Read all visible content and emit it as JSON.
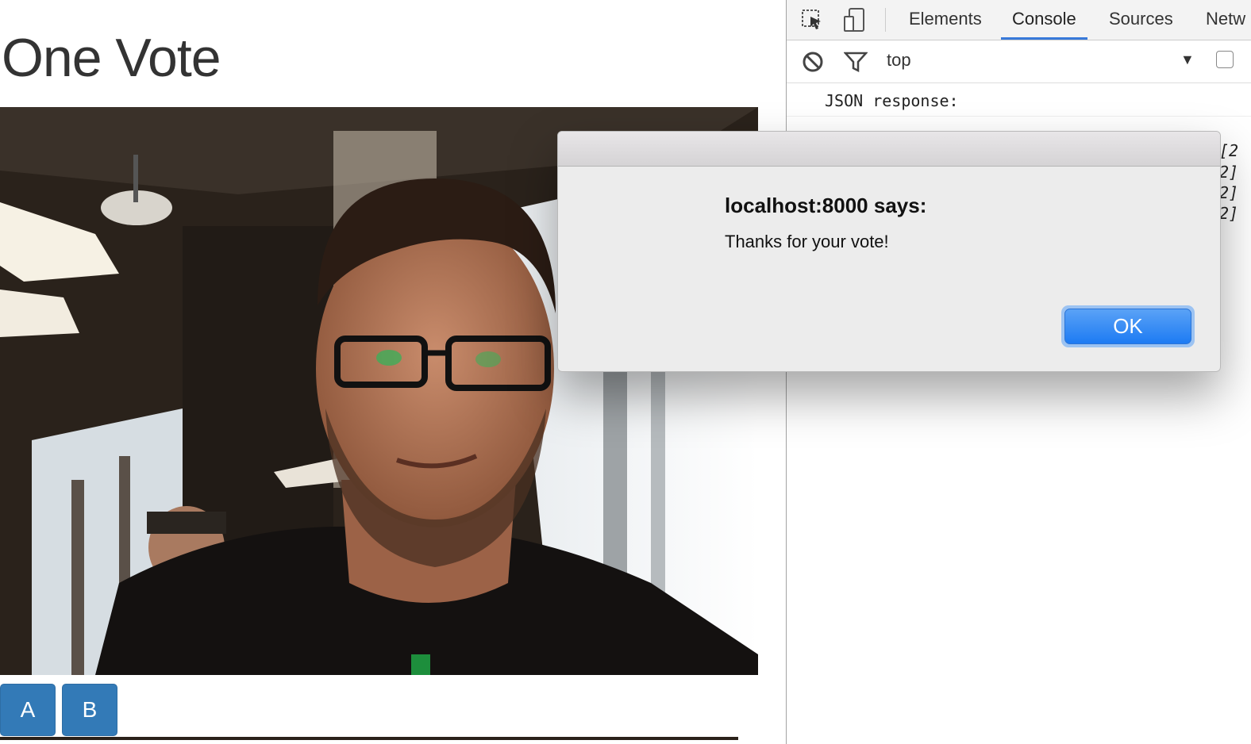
{
  "page": {
    "title": "One Vote",
    "buttons": {
      "a": "A",
      "b": "B"
    }
  },
  "devtools": {
    "tabs": [
      "Elements",
      "Console",
      "Sources",
      "Netw"
    ],
    "active_tab": "Console",
    "context": "top",
    "console_line": "JSON response:",
    "output_fragments": [
      "[2",
      "2]",
      "2]",
      "2]"
    ]
  },
  "dialog": {
    "heading": "localhost:8000 says:",
    "message": "Thanks for your vote!",
    "ok_label": "OK"
  },
  "colors": {
    "button_primary": "#337ab7",
    "devtools_tab_active": "#3879d9",
    "dialog_ok": "#1d7bf3"
  }
}
